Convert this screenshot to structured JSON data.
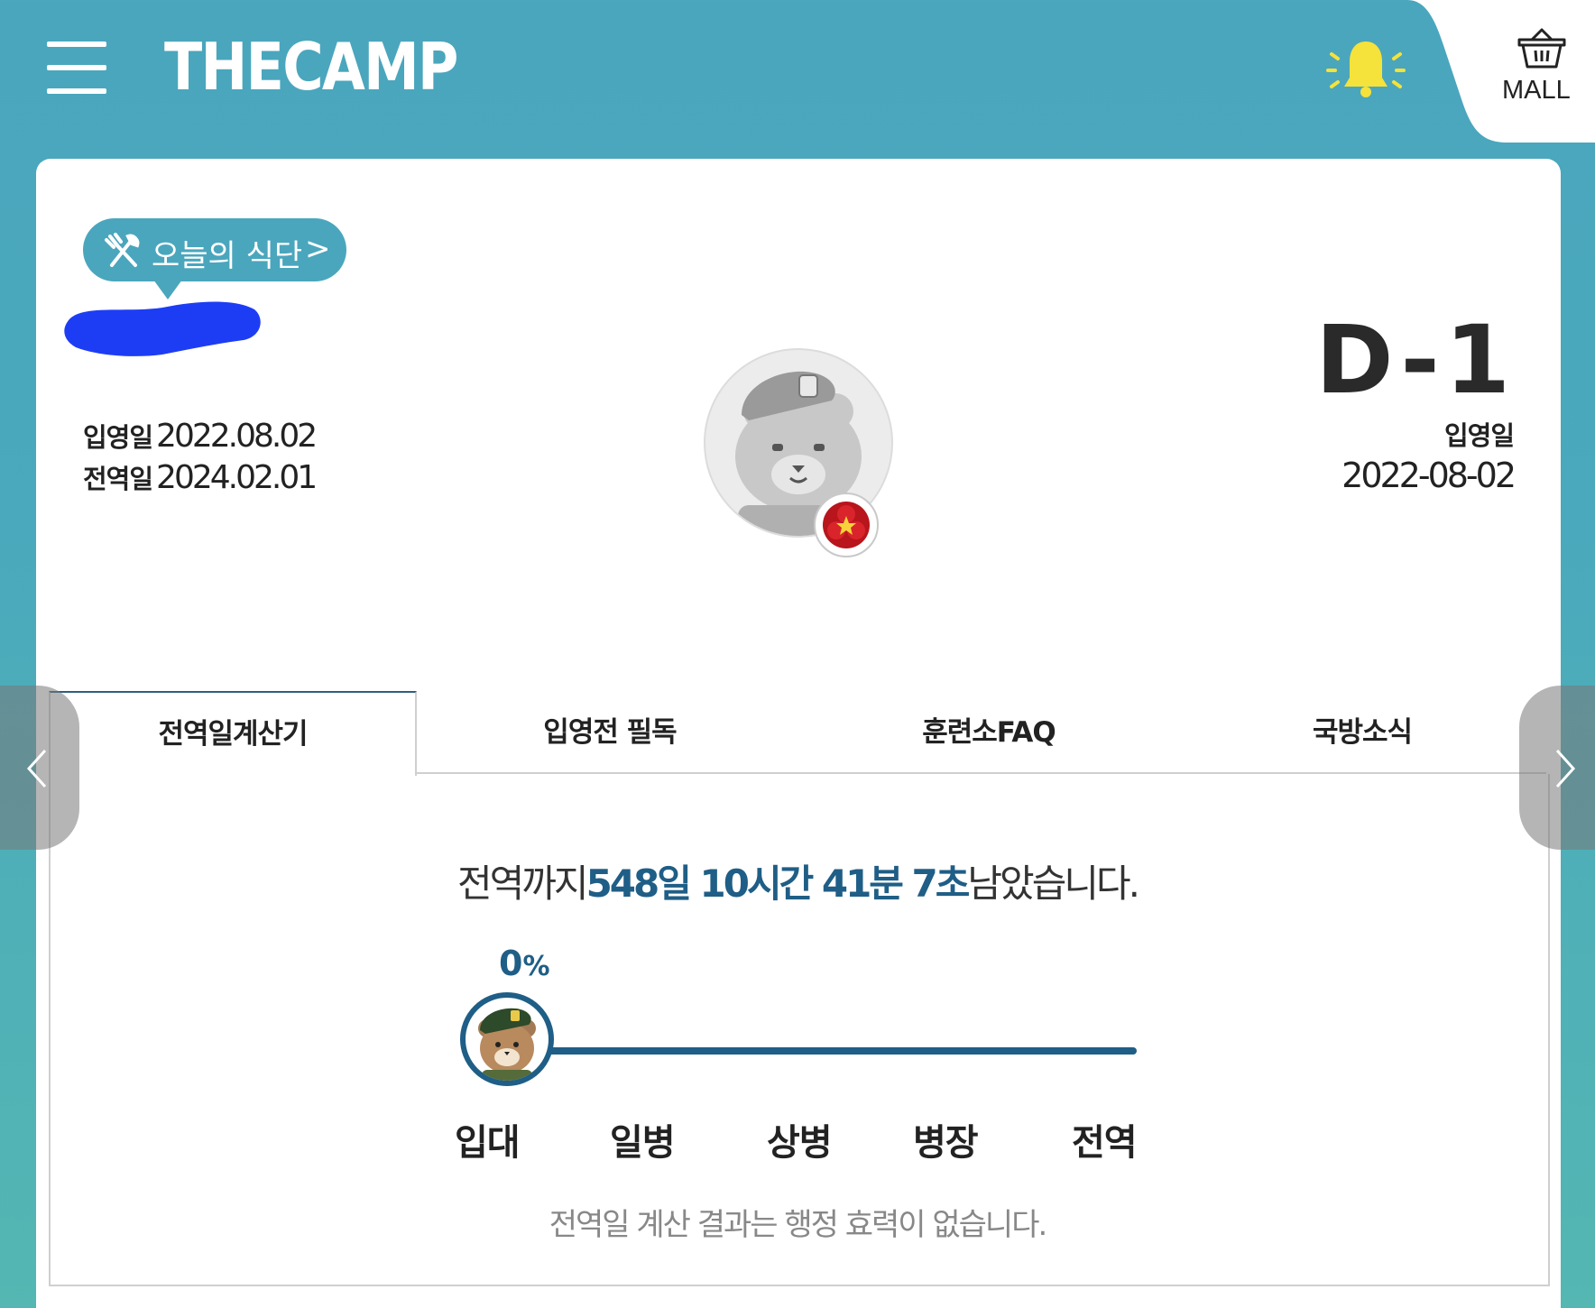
{
  "header": {
    "logo": "THECAMP",
    "mall_label": "MALL",
    "icons": [
      "menu-icon",
      "bell-icon",
      "basket-icon"
    ]
  },
  "profile": {
    "meal_button": "오늘의 식단",
    "enlist_label": "입영일",
    "enlist_date": "2022.08.02",
    "discharge_label": "전역일",
    "discharge_date": "2024.02.01",
    "dday": "D-1",
    "right_enlist_label": "입영일",
    "right_enlist_date": "2022-08-02"
  },
  "tabs": [
    {
      "label": "전역일계산기",
      "active": true
    },
    {
      "label": "입영전 필독",
      "active": false
    },
    {
      "label": "훈련소FAQ",
      "active": false
    },
    {
      "label": "국방소식",
      "active": false
    }
  ],
  "calculator": {
    "remain_prefix": "전역까지",
    "remain_value": "548일 10시간 41분 7초",
    "remain_suffix": "남았습니다.",
    "progress_number": "0",
    "progress_unit": "%",
    "progress": 0,
    "stages": [
      "입대",
      "일병",
      "상병",
      "병장",
      "전역"
    ],
    "notice": "전역일 계산 결과는 행정 효력이 없습니다."
  },
  "colors": {
    "header_bg": "#4aa6bd",
    "accent": "#1f5e86",
    "bell": "#f5e23a"
  }
}
